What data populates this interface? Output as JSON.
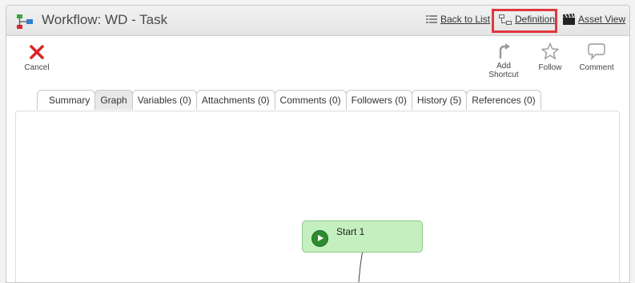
{
  "header": {
    "title": "Workflow: WD - Task",
    "links": {
      "back_to_list": "Back to List",
      "definition": "Definition",
      "asset_view": "Asset View"
    }
  },
  "toolbar": {
    "cancel": "Cancel",
    "add_shortcut": "Add Shortcut",
    "follow": "Follow",
    "comment": "Comment"
  },
  "tabs": [
    {
      "label": "Summary",
      "active": false
    },
    {
      "label": "Graph",
      "active": true
    },
    {
      "label": "Variables (0)",
      "active": false
    },
    {
      "label": "Attachments (0)",
      "active": false
    },
    {
      "label": "Comments (0)",
      "active": false
    },
    {
      "label": "Followers (0)",
      "active": false
    },
    {
      "label": "History (5)",
      "active": false
    },
    {
      "label": "References (0)",
      "active": false
    }
  ],
  "graph": {
    "start_node": "Start 1"
  },
  "colors": {
    "cancel_red": "#d9262b",
    "highlight_red": "#e0383e",
    "node_fill": "#c4f0c0",
    "play_green": "#2e8b2e"
  }
}
